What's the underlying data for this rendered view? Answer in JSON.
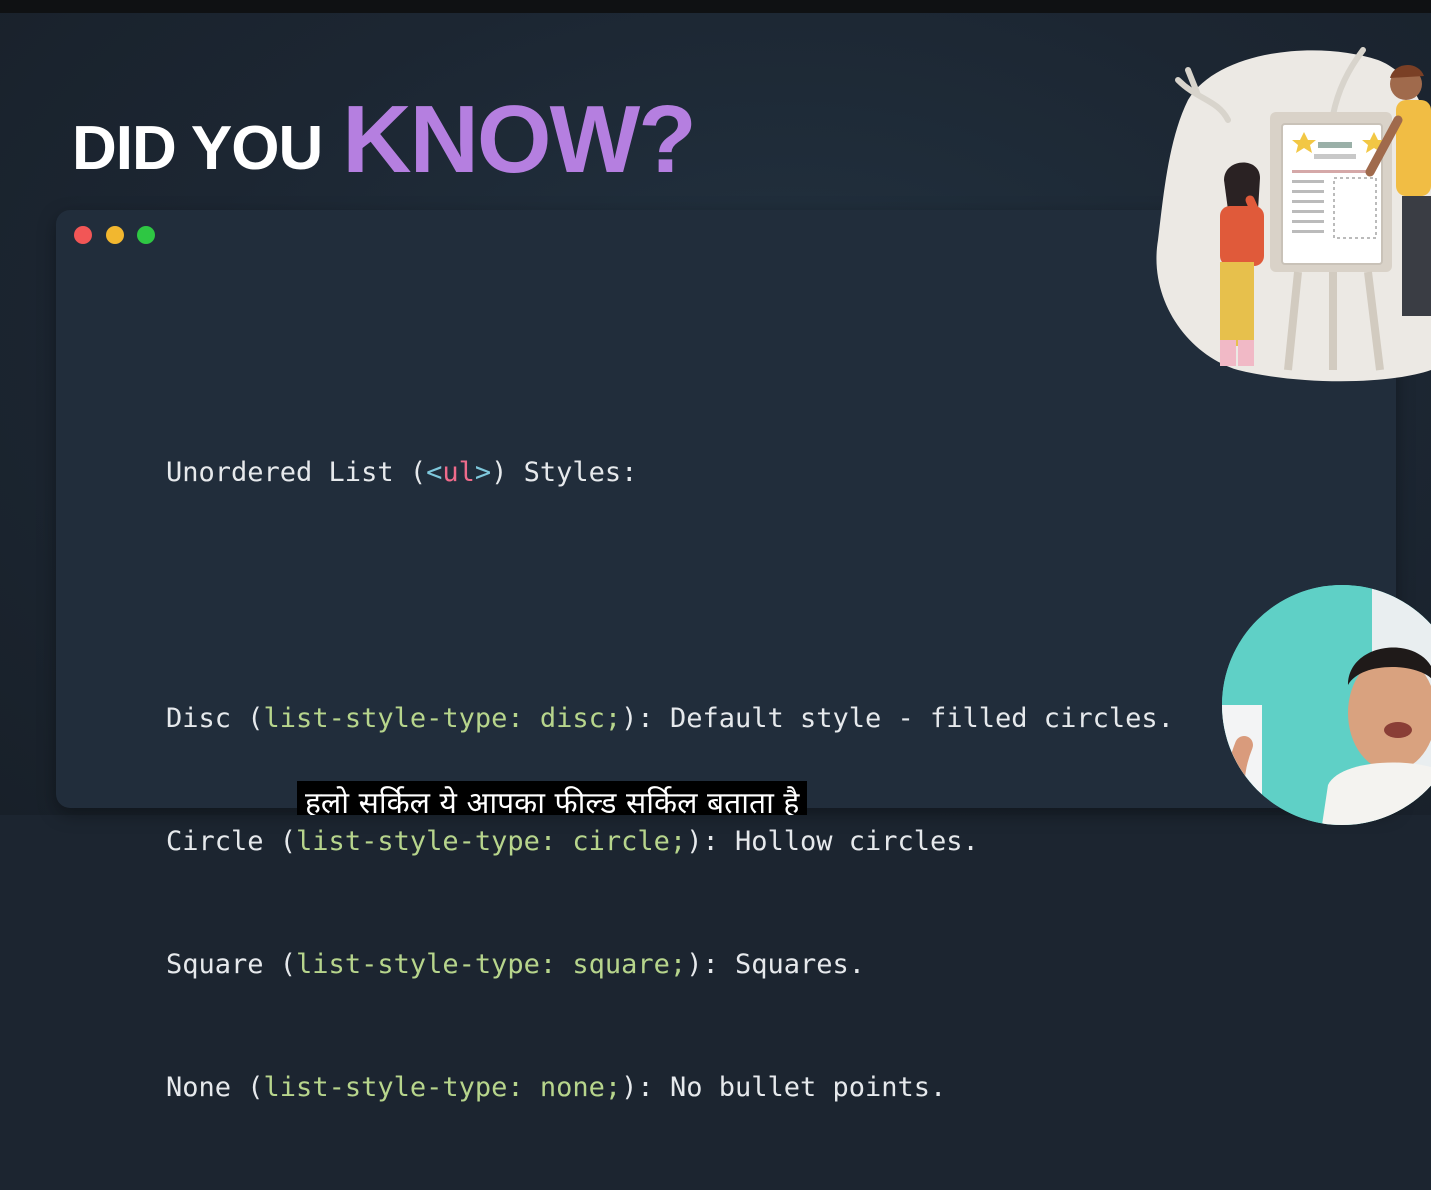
{
  "headline": {
    "part1": "DID YOU",
    "part2": "KNOW?"
  },
  "code_window": {
    "window_controls": [
      "close",
      "minimize",
      "maximize"
    ],
    "heading": {
      "prefix": "Unordered List (",
      "tag_open": "<",
      "tag_name": "ul",
      "tag_close": ">",
      "suffix": ") Styles:"
    },
    "items": [
      {
        "name": "Disc (",
        "code": "list-style-type: disc;",
        "description": "): Default style - filled circles."
      },
      {
        "name": "Circle (",
        "code": "list-style-type: circle;",
        "description": "): Hollow circles."
      },
      {
        "name": "Square (",
        "code": "list-style-type: square;",
        "description": "): Squares."
      },
      {
        "name": "None (",
        "code": "list-style-type: none;",
        "description": "): No bullet points."
      }
    ]
  },
  "subtitle": "हलो सर्किल ये आपका फील्ड सर्किल बताता है",
  "colors": {
    "accent": "#b57fe0",
    "code_keyword": "#b7d58c",
    "tag_name": "#ef6b8b",
    "close_dot": "#f25656",
    "minimize_dot": "#f2b72f",
    "maximize_dot": "#2ec743"
  },
  "icons": {
    "illustration": "teacher-student-whiteboard-illustration",
    "avatar": "presenter-webcam-avatar"
  }
}
